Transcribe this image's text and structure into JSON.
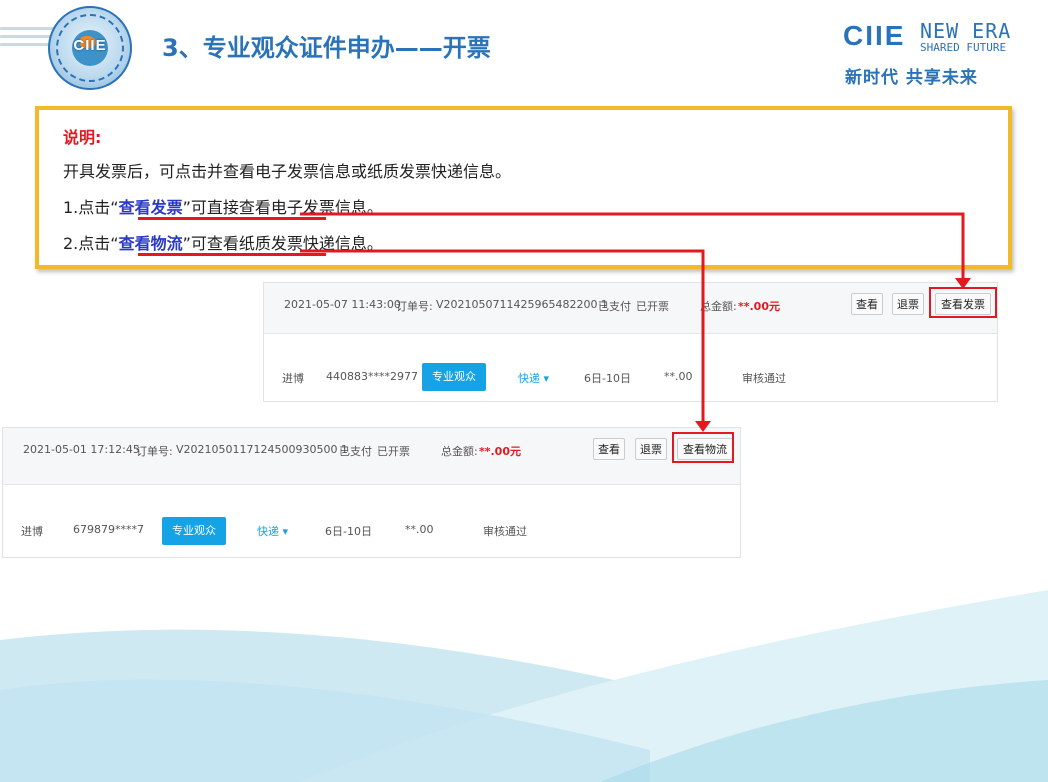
{
  "header": {
    "title": "3、专业观众证件申办——开票",
    "logo_text": "CIIE",
    "brand": {
      "name": "CIIE",
      "tag_line1": "NEW ERA",
      "tag_line2": "SHARED FUTURE",
      "slogan_cn": "新时代 共享未来"
    }
  },
  "note": {
    "heading": "说明:",
    "line1": "开具发票后，可点击并查看电子发票信息或纸质发票快递信息。",
    "line2": {
      "prefix": "1.点击“",
      "highlight": "查看发票",
      "suffix": "”可直接查看电子发票信息。"
    },
    "line3": {
      "prefix": "2.点击“",
      "highlight": "查看物流",
      "suffix": "”可查看纸质发票快递信息。"
    }
  },
  "orders": [
    {
      "datetime": "2021-05-07 11:43:00",
      "order_label": "订单号:",
      "order_no": "V2021050711425965482200 1",
      "paid": "已支付",
      "invoiced": "已开票",
      "total_label": "总金额:",
      "total_value": "**.00元",
      "buttons": {
        "view": "查看",
        "refund": "退票",
        "extra": "查看发票"
      },
      "row": {
        "venue": "进博",
        "id": "440883****2977",
        "type": "专业观众",
        "shipping": "快递 ▾",
        "period": "6日-10日",
        "price": "**.00",
        "status": "审核通过"
      }
    },
    {
      "datetime": "2021-05-01 17:12:45",
      "order_label": "订单号:",
      "order_no": "V2021050117124500930500 1",
      "paid": "已支付",
      "invoiced": "已开票",
      "total_label": "总金额:",
      "total_value": "**.00元",
      "buttons": {
        "view": "查看",
        "refund": "退票",
        "extra": "查看物流"
      },
      "row": {
        "venue": "进博",
        "id": "679879****7",
        "type": "专业观众",
        "shipping": "快递 ▾",
        "period": "6日-10日",
        "price": "**.00",
        "status": "审核通过"
      }
    }
  ]
}
